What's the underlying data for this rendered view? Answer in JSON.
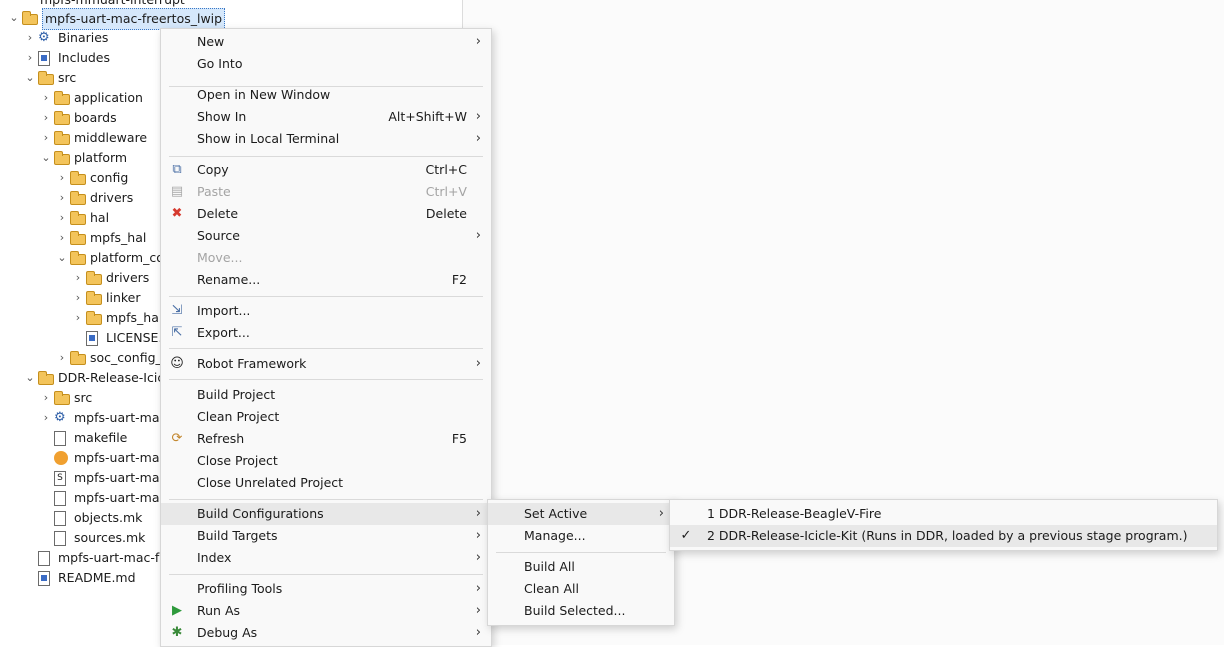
{
  "tree": {
    "top_cut": "mpfs-mmuart-interrupt",
    "rows": [
      {
        "label": "mpfs-uart-mac-freertos_lwip",
        "type": "project"
      },
      {
        "label": "Binaries",
        "type": "gear"
      },
      {
        "label": "Includes",
        "type": "includes"
      },
      {
        "label": "src",
        "type": "folder"
      },
      {
        "label": "application",
        "type": "folder"
      },
      {
        "label": "boards",
        "type": "folder"
      },
      {
        "label": "middleware",
        "type": "folder"
      },
      {
        "label": "platform",
        "type": "folder"
      },
      {
        "label": "config",
        "type": "folder"
      },
      {
        "label": "drivers",
        "type": "folder"
      },
      {
        "label": "hal",
        "type": "folder"
      },
      {
        "label": "mpfs_hal",
        "type": "folder"
      },
      {
        "label": "platform_co",
        "type": "folder"
      },
      {
        "label": "drivers",
        "type": "folder"
      },
      {
        "label": "linker",
        "type": "folder"
      },
      {
        "label": "mpfs_hal_",
        "type": "folder"
      },
      {
        "label": "LICENSE.",
        "type": "file-dark"
      },
      {
        "label": "soc_config_g",
        "type": "folder"
      },
      {
        "label": "DDR-Release-Icicl",
        "type": "folder"
      },
      {
        "label": "src",
        "type": "folder"
      },
      {
        "label": "mpfs-uart-mac",
        "type": "gear"
      },
      {
        "label": "makefile",
        "type": "file"
      },
      {
        "label": "mpfs-uart-mac",
        "type": "orange"
      },
      {
        "label": "mpfs-uart-mac",
        "type": "s-file"
      },
      {
        "label": "mpfs-uart-mac",
        "type": "file"
      },
      {
        "label": "objects.mk",
        "type": "file"
      },
      {
        "label": "sources.mk",
        "type": "file"
      },
      {
        "label": "mpfs-uart-mac-fr",
        "type": "file"
      },
      {
        "label": "README.md",
        "type": "file-dark"
      }
    ]
  },
  "context_menu": {
    "items": [
      {
        "label": "New",
        "accel": "",
        "submenu": true,
        "icon": ""
      },
      {
        "label": "Go Into",
        "accel": "",
        "submenu": false,
        "icon": ""
      },
      {
        "label": "Open in New Window",
        "accel": "",
        "submenu": false,
        "icon": ""
      },
      {
        "label": "Show In",
        "accel": "Alt+Shift+W",
        "submenu": true,
        "icon": ""
      },
      {
        "label": "Show in Local Terminal",
        "accel": "",
        "submenu": true,
        "icon": ""
      },
      {
        "label": "Copy",
        "accel": "Ctrl+C",
        "submenu": false,
        "icon": "copy-icon"
      },
      {
        "label": "Paste",
        "accel": "Ctrl+V",
        "submenu": false,
        "icon": "paste-icon",
        "disabled": true
      },
      {
        "label": "Delete",
        "accel": "Delete",
        "submenu": false,
        "icon": "delete-icon"
      },
      {
        "label": "Source",
        "accel": "",
        "submenu": true,
        "icon": ""
      },
      {
        "label": "Move...",
        "accel": "",
        "submenu": false,
        "icon": "",
        "disabled": true
      },
      {
        "label": "Rename...",
        "accel": "F2",
        "submenu": false,
        "icon": ""
      },
      {
        "label": "Import...",
        "accel": "",
        "submenu": false,
        "icon": "import-icon"
      },
      {
        "label": "Export...",
        "accel": "",
        "submenu": false,
        "icon": "export-icon"
      },
      {
        "label": "Robot Framework",
        "accel": "",
        "submenu": true,
        "icon": "robot-icon"
      },
      {
        "label": "Build Project",
        "accel": "",
        "submenu": false,
        "icon": ""
      },
      {
        "label": "Clean Project",
        "accel": "",
        "submenu": false,
        "icon": ""
      },
      {
        "label": "Refresh",
        "accel": "F5",
        "submenu": false,
        "icon": "refresh-icon"
      },
      {
        "label": "Close Project",
        "accel": "",
        "submenu": false,
        "icon": ""
      },
      {
        "label": "Close Unrelated Project",
        "accel": "",
        "submenu": false,
        "icon": ""
      },
      {
        "label": "Build Configurations",
        "accel": "",
        "submenu": true,
        "icon": "",
        "highlighted": true
      },
      {
        "label": "Build Targets",
        "accel": "",
        "submenu": true,
        "icon": ""
      },
      {
        "label": "Index",
        "accel": "",
        "submenu": true,
        "icon": ""
      },
      {
        "label": "Profiling Tools",
        "accel": "",
        "submenu": true,
        "icon": ""
      },
      {
        "label": "Run As",
        "accel": "",
        "submenu": true,
        "icon": "run-icon"
      },
      {
        "label": "Debug As",
        "accel": "",
        "submenu": true,
        "icon": "debug-icon"
      }
    ]
  },
  "build_config_menu": {
    "items": [
      {
        "label": "Set Active",
        "submenu": true,
        "highlighted": true
      },
      {
        "label": "Manage...",
        "submenu": false
      },
      {
        "label": "Build All",
        "submenu": false
      },
      {
        "label": "Clean All",
        "submenu": false
      },
      {
        "label": "Build Selected...",
        "submenu": false
      }
    ]
  },
  "set_active_menu": {
    "items": [
      {
        "label": "1 DDR-Release-BeagleV-Fire",
        "checked": false
      },
      {
        "label": "2 DDR-Release-Icicle-Kit (Runs in DDR, loaded by a previous stage program.)",
        "checked": true,
        "highlighted": true
      }
    ]
  },
  "glyphs": {
    "check": "✓",
    "arrow": "›",
    "chev_down": "⌄",
    "chev_right": "›"
  }
}
